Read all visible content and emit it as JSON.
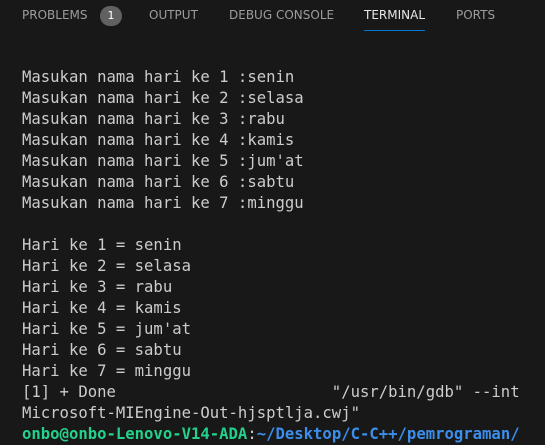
{
  "tabs": {
    "problems": "PROBLEMS",
    "problems_count": "1",
    "output": "OUTPUT",
    "debug_console": "DEBUG CONSOLE",
    "terminal": "TERMINAL",
    "ports": "PORTS"
  },
  "terminal": {
    "input_lines": [
      "Masukan nama hari ke 1 :senin",
      "Masukan nama hari ke 2 :selasa",
      "Masukan nama hari ke 3 :rabu",
      "Masukan nama hari ke 4 :kamis",
      "Masukan nama hari ke 5 :jum'at",
      "Masukan nama hari ke 6 :sabtu",
      "Masukan nama hari ke 7 :minggu"
    ],
    "output_lines": [
      "Hari ke 1 = senin",
      "Hari ke 2 = selasa",
      "Hari ke 3 = rabu",
      "Hari ke 4 = kamis",
      "Hari ke 5 = jum'at",
      "Hari ke 6 = sabtu",
      "Hari ke 7 = minggu"
    ],
    "job_line": "[1] + Done                       \"/usr/bin/gdb\" --int",
    "engine_line": "Microsoft-MIEngine-Out-hjsptlja.cwj\"",
    "prompt_user": "onbo@onbo-Lenovo-V14-ADA",
    "prompt_colon": ":",
    "prompt_path": "~/Desktop/C-C++/pemrograman/"
  },
  "colors": {
    "background": "#181818",
    "text": "#cccccc",
    "prompt_user": "#23d18b",
    "prompt_path": "#3b8eea",
    "active_tab_underline": "#0078d4"
  }
}
